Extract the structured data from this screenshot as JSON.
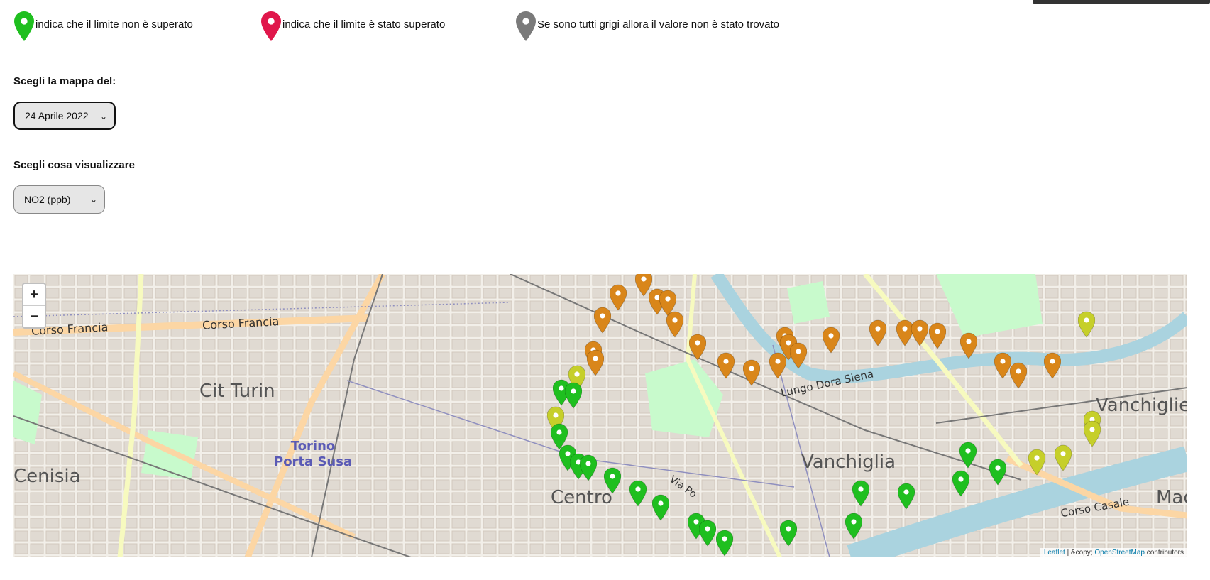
{
  "legend": {
    "items": [
      {
        "text": "indica che il limite non è superato",
        "color": "#1fbf1f",
        "icon": "map-pin-green"
      },
      {
        "text": "indica che il limite è stato superato",
        "color": "#e0174b",
        "icon": "map-pin-red"
      },
      {
        "text": "Se sono tutti grigi allora il valore non è stato trovato",
        "color": "#7a7a7a",
        "icon": "map-pin-grey"
      }
    ]
  },
  "controls": {
    "date_label": "Scegli la mappa del:",
    "date_value": "24 Aprile 2022",
    "pollutant_label": "Scegli cosa visualizzare",
    "pollutant_value": "NO2 (ppb)"
  },
  "map": {
    "zoom_in": "+",
    "zoom_out": "−",
    "labels": {
      "corso_francia_1": "Corso Francia",
      "corso_francia_2": "Corso Francia",
      "cit_turin": "Cit Turin",
      "cenisia": "Cenisia",
      "porta_susa": "Torino\nPorta Susa",
      "centro": "Centro",
      "via_po": "Via Po",
      "vanchiglia": "Vanchiglia",
      "vanchiglietta": "Vanchigliet",
      "lungo_dora": "Lungo Dora Siena",
      "corso_casale": "Corso Casale",
      "mad": "Mad"
    },
    "attribution": {
      "leaflet": "Leaflet",
      "middle": " | &copy; ",
      "osm": "OpenStreetMap",
      "contributors": " contributors"
    },
    "colors": {
      "green": "#1fbf1f",
      "orange": "#d9861a",
      "yellow": "#c6cf2a",
      "river": "#aad3df",
      "park": "#c8facc"
    }
  }
}
